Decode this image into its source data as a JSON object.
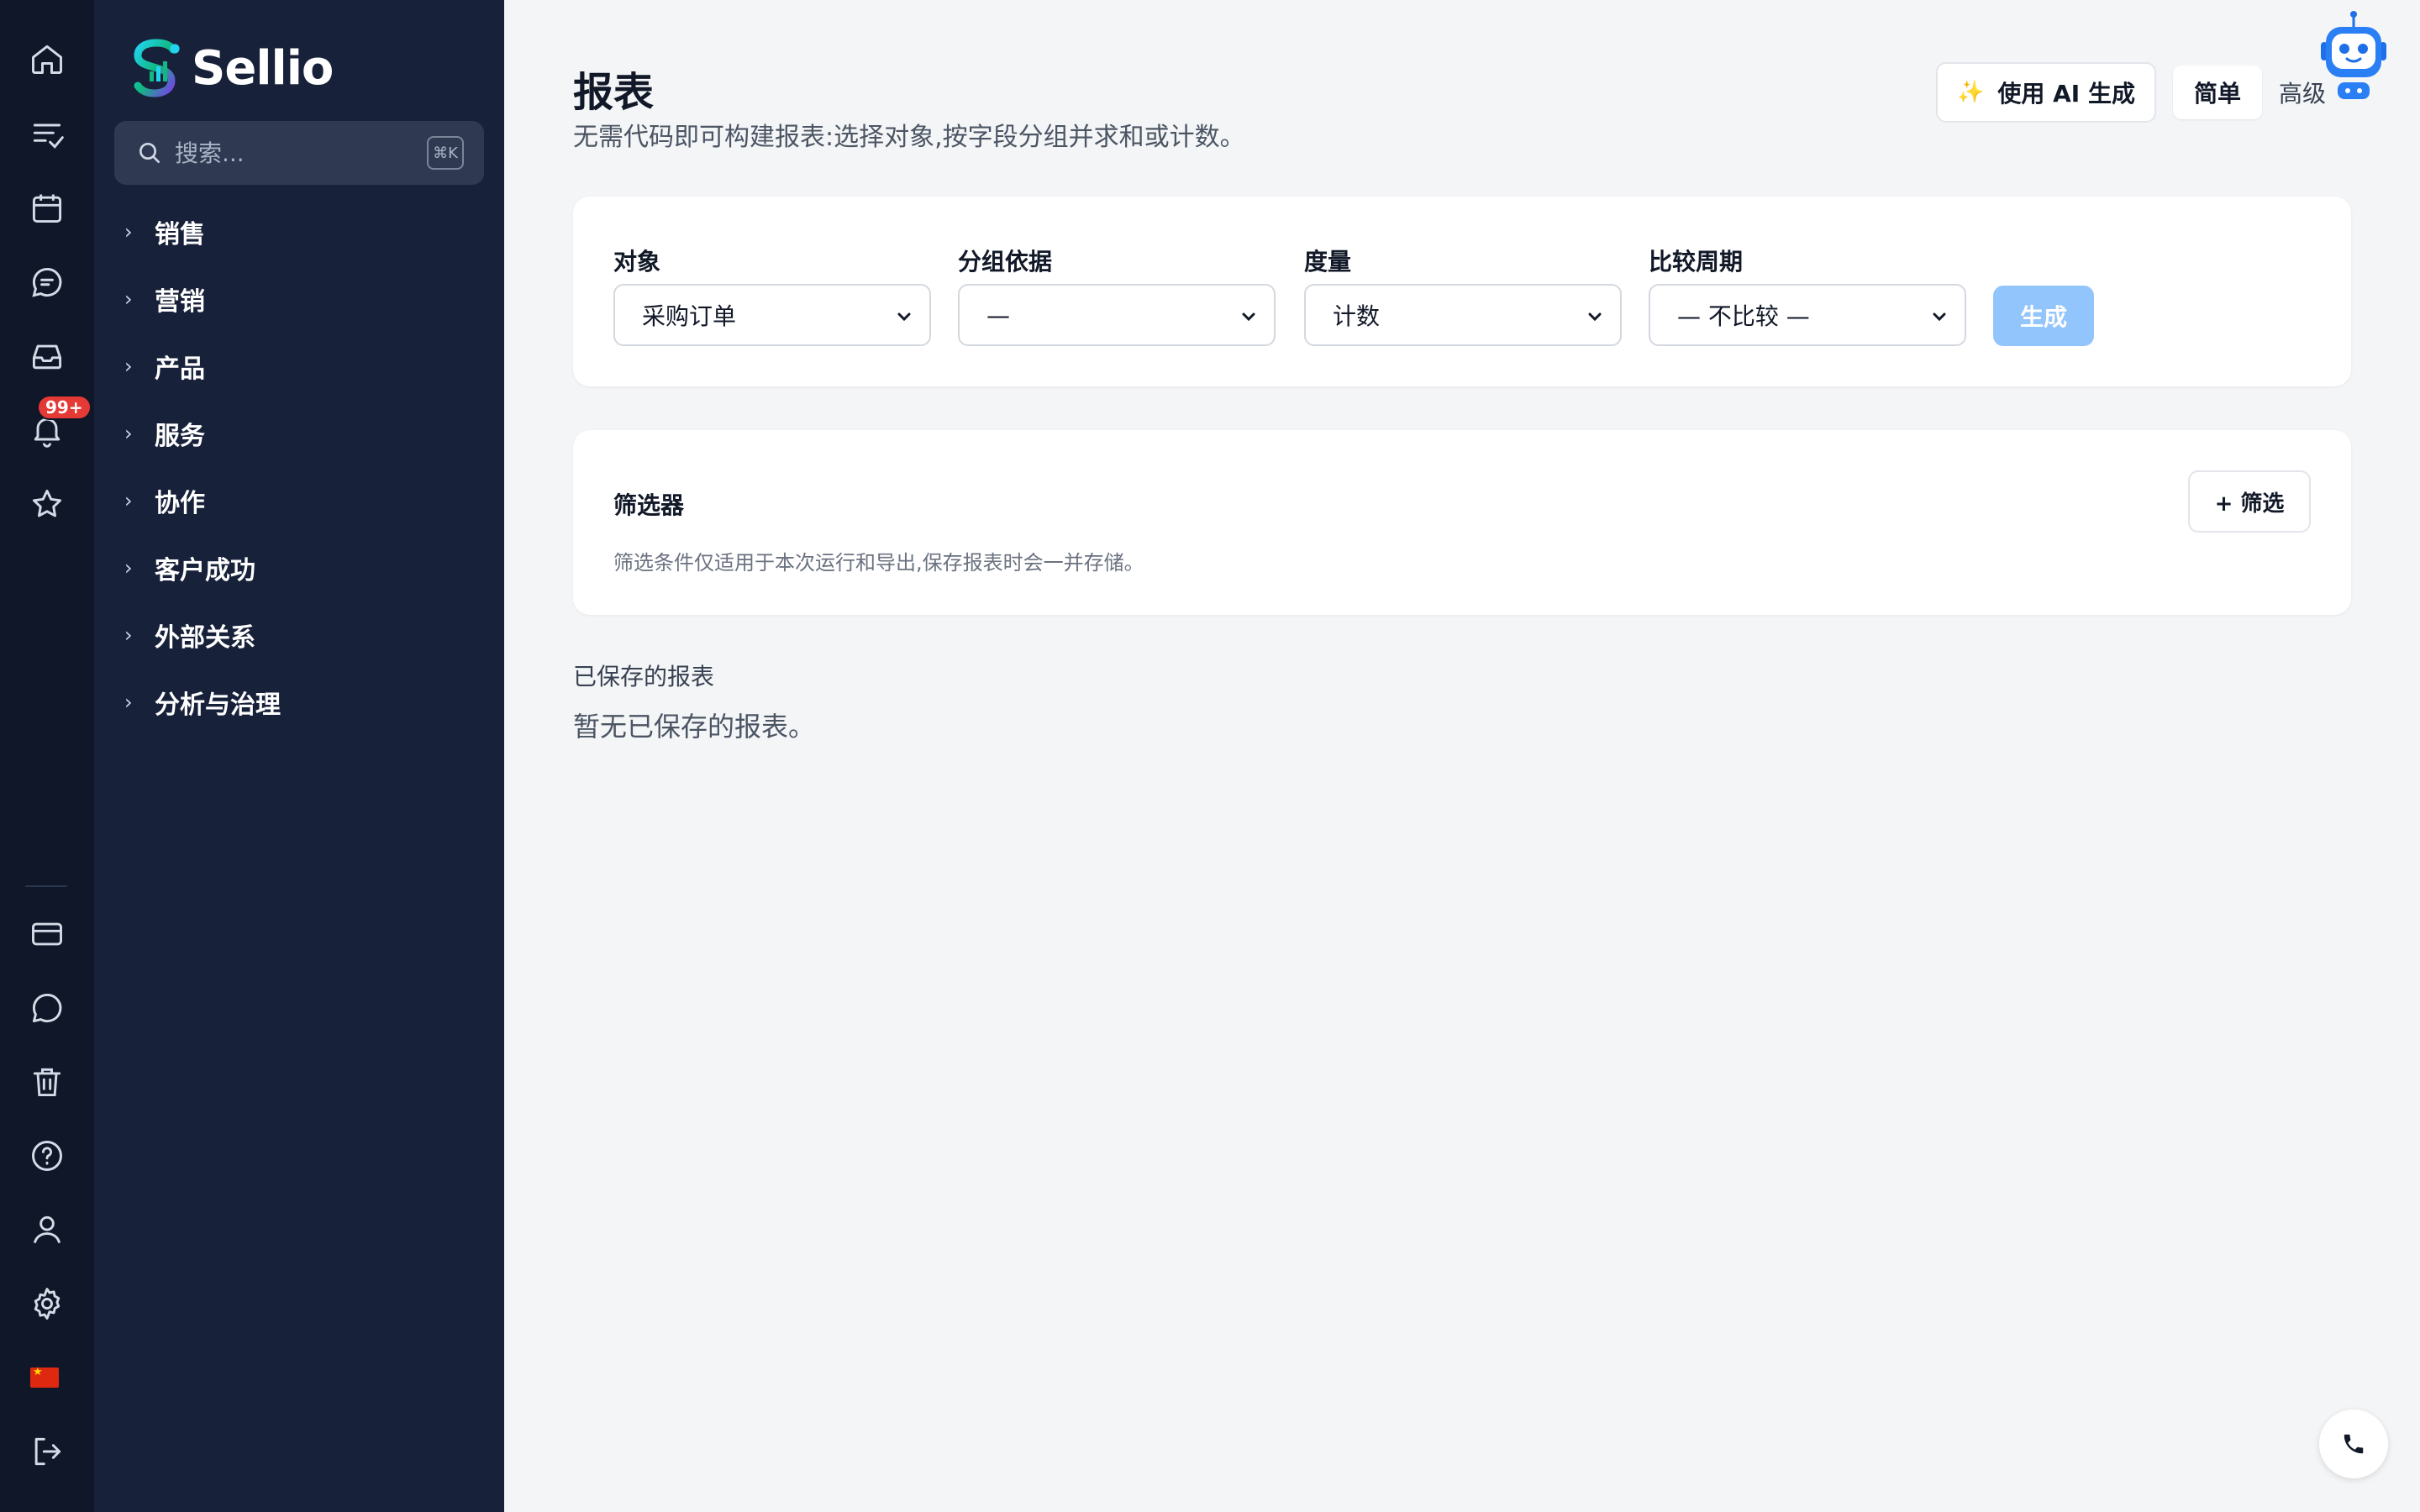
{
  "brand": {
    "name": "Sellio"
  },
  "search": {
    "placeholder": "搜索...",
    "shortcut": "⌘K"
  },
  "rail": {
    "notifications_badge": "99+"
  },
  "nav": {
    "items": [
      {
        "label": "销售"
      },
      {
        "label": "营销"
      },
      {
        "label": "产品"
      },
      {
        "label": "服务"
      },
      {
        "label": "协作"
      },
      {
        "label": "客户成功"
      },
      {
        "label": "外部关系"
      },
      {
        "label": "分析与治理"
      }
    ]
  },
  "page": {
    "title": "报表",
    "subtitle": "无需代码即可构建报表:选择对象,按字段分组并求和或计数。"
  },
  "toolbar": {
    "ai_label": "使用 AI 生成",
    "ai_icon": "✨",
    "simple_label": "简单",
    "advanced_label": "高级"
  },
  "config": {
    "object": {
      "label": "对象",
      "value": "采购订单"
    },
    "group_by": {
      "label": "分组依据",
      "value": "—"
    },
    "measure": {
      "label": "度量",
      "value": "计数"
    },
    "compare": {
      "label": "比较周期",
      "value": "— 不比较 —"
    },
    "generate_label": "生成"
  },
  "filters": {
    "title": "筛选器",
    "add_label": "+ 筛选",
    "description": "筛选条件仅适用于本次运行和导出,保存报表时会一并存储。"
  },
  "saved": {
    "title": "已保存的报表",
    "empty": "暂无已保存的报表。"
  },
  "colors": {
    "rail_bg": "#0f1729",
    "sidebar_bg": "#17213a",
    "accent": "#93c5fd",
    "badge": "#e53935"
  }
}
